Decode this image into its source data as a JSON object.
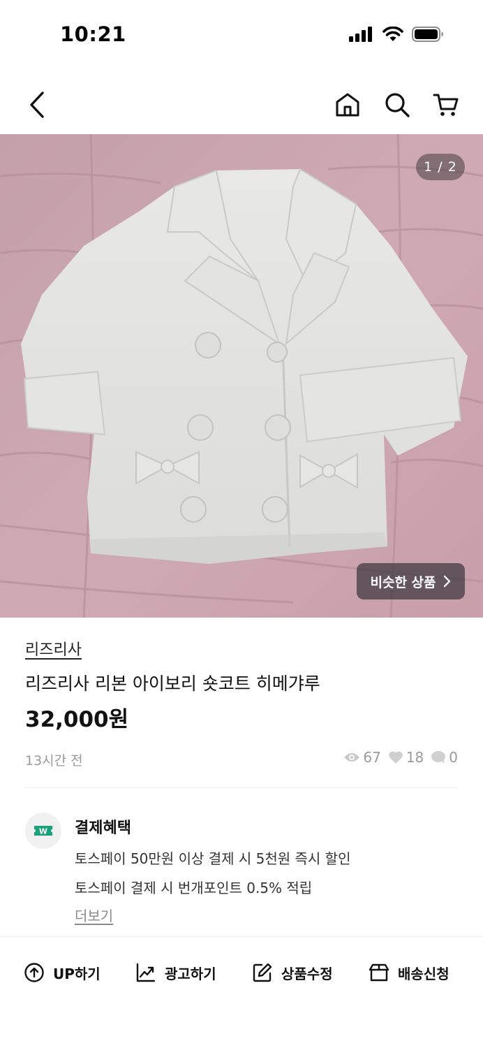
{
  "status_bar": {
    "time": "10:21"
  },
  "nav": {
    "icons": [
      "back-arrow-icon",
      "home-icon",
      "search-icon",
      "cart-icon"
    ]
  },
  "product_image": {
    "page_indicator": "1 / 2",
    "similar_button": "비슷한 상품",
    "similar_button_chevron": "chevron-right-icon"
  },
  "product": {
    "shop_name": "리즈리사",
    "title": "리즈리사 리본 아이보리 숏코트 히메갸루",
    "price": "32,000원",
    "posted": "13시간 전",
    "stats": {
      "views": "67",
      "likes": "18",
      "chats": "0"
    }
  },
  "payment_benefits": {
    "title": "결제혜택",
    "line1": "토스페이 50만원 이상 결제 시 5천원 즉시 할인",
    "line2": "토스페이 결제 시 번개포인트 0.5% 적립",
    "more": "더보기",
    "icon_color": "#1aa07a"
  },
  "actions": {
    "up": "UP하기",
    "ad": "광고하기",
    "edit": "상품수정",
    "ship": "배송신청"
  }
}
